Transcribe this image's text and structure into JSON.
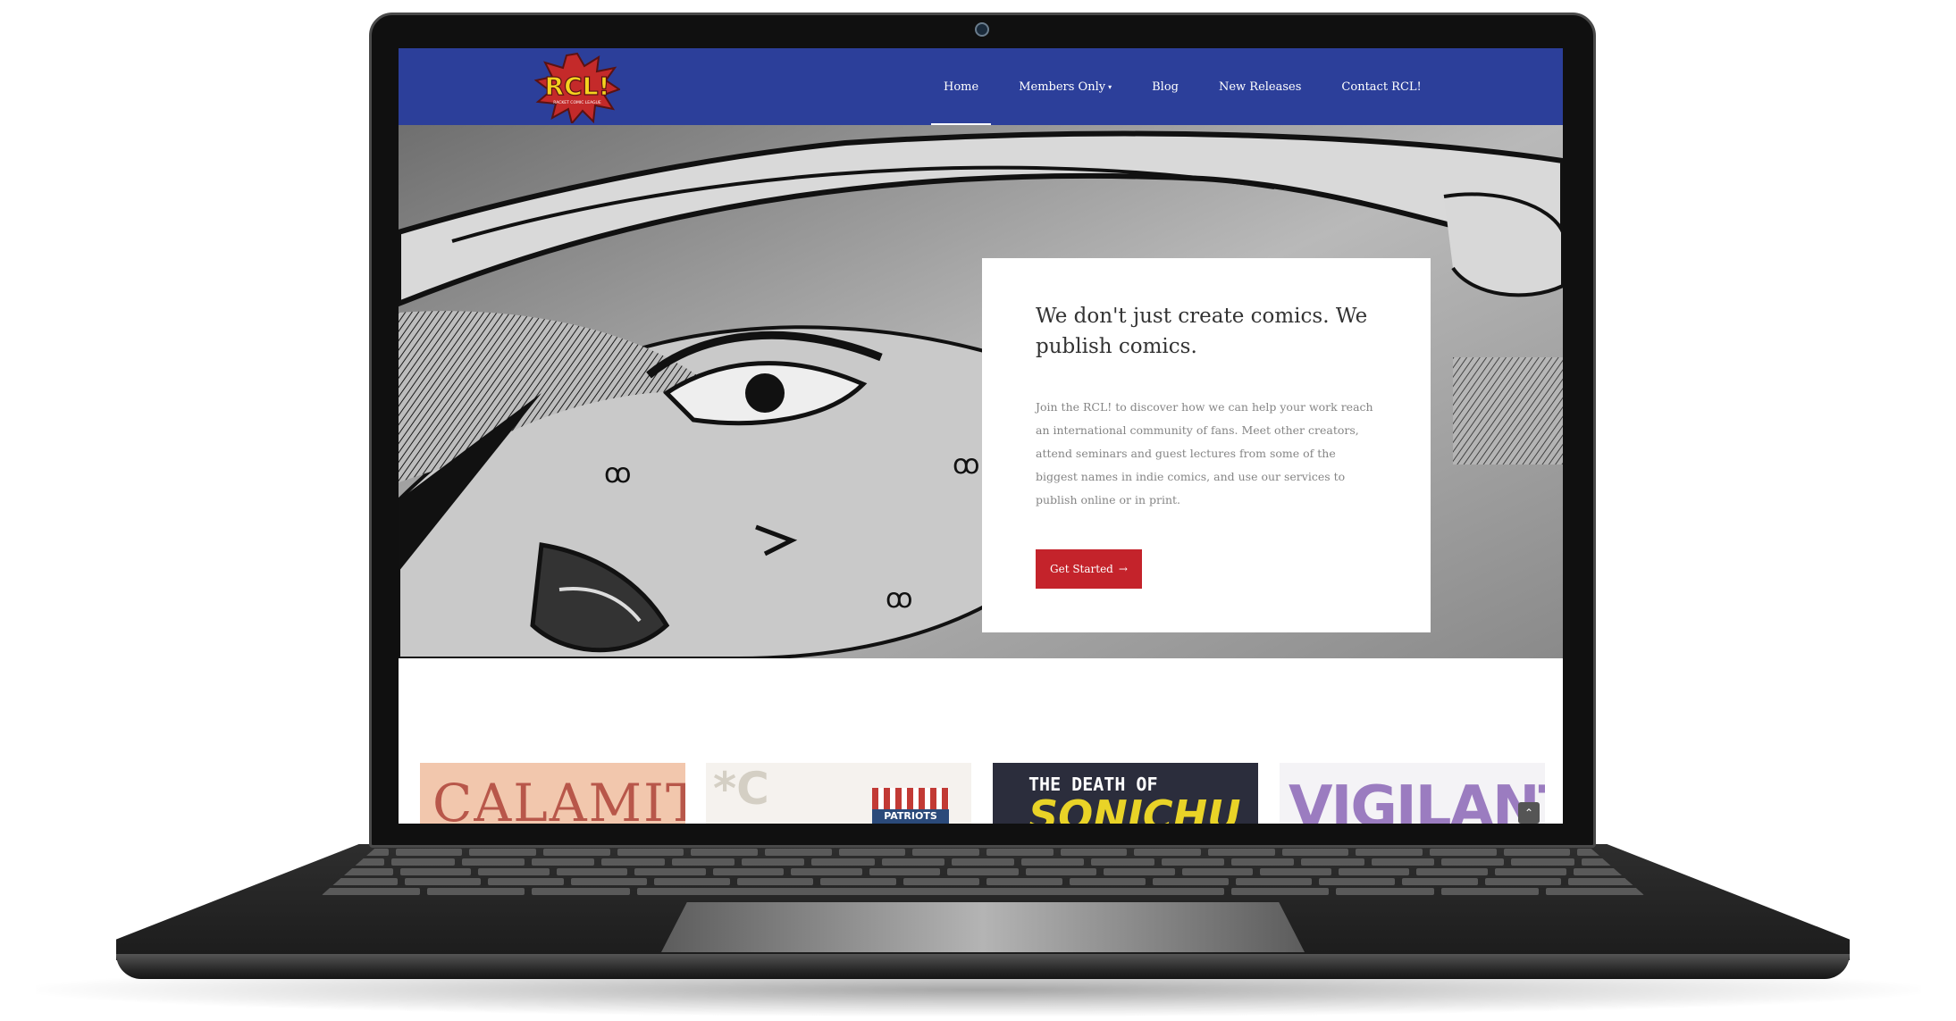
{
  "header": {
    "logo_text": "RCL!",
    "logo_subtitle": "RACKET COMIC LEAGUE"
  },
  "nav": {
    "items": [
      {
        "label": "Home",
        "active": true
      },
      {
        "label": "Members Only",
        "has_dropdown": true
      },
      {
        "label": "Blog"
      },
      {
        "label": "New Releases"
      },
      {
        "label": "Contact RCL!"
      }
    ],
    "dropdown_glyph": "▾"
  },
  "hero": {
    "title": "We don't just create comics. We publish comics.",
    "body": "Join the RCL! to discover how we can help your work reach an international community of fans. Meet other creators, attend seminars and guest lectures from some of the biggest names in indie comics, and use our services to publish online or in print.",
    "cta_label": "Get Started",
    "cta_icon": "→"
  },
  "releases": [
    {
      "title": "CALAMITY"
    },
    {
      "title": "*C",
      "badge": "PATRIOTS"
    },
    {
      "title_line1": "THE DEATH OF",
      "title_line2": "SONICHU"
    },
    {
      "title": "VIGILANT"
    }
  ],
  "scroll_top_icon": "⌃",
  "colors": {
    "nav_bg": "#2c3f9a",
    "cta_bg": "#c4232b",
    "card_bg": "#ffffff",
    "heading_text": "#333333",
    "body_text": "#858585"
  }
}
